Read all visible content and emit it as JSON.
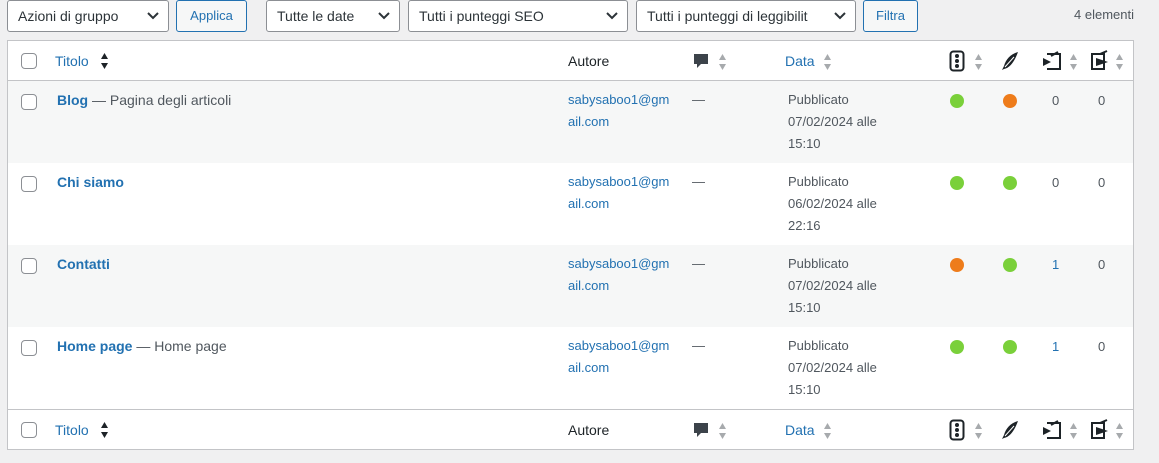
{
  "filters": {
    "bulk_actions": "Azioni di gruppo",
    "apply_label": "Applica",
    "dates": "Tutte le date",
    "seo_scores": "Tutti i punteggi SEO",
    "readability_scores": "Tutti i punteggi di leggibilit",
    "filter_label": "Filtra",
    "item_count": "4 elementi"
  },
  "columns": {
    "title": "Titolo",
    "author": "Autore",
    "date": "Data"
  },
  "icons": {
    "comments": "speech-bubble-icon",
    "seo": "traffic-light-icon",
    "readability": "feather-icon",
    "internal_links_in": "link-in-icon",
    "internal_links_out": "link-out-icon",
    "sort": "sort-arrows-icon"
  },
  "colors": {
    "good": "#7ad03a",
    "ok": "#ee7c1b",
    "link": "#2271b1"
  },
  "rows": [
    {
      "title": "Blog",
      "state": "— Pagina degli articoli",
      "author_l1": "sabysaboo1@gm",
      "author_l2": "ail.com",
      "comments": "—",
      "date_status": "Pubblicato",
      "date_day": "07/02/2024 alle",
      "date_time": "15:10",
      "seo": "good",
      "readability": "ok",
      "links_in": "0",
      "links_out": "0"
    },
    {
      "title": "Chi siamo",
      "state": "",
      "author_l1": "sabysaboo1@gm",
      "author_l2": "ail.com",
      "comments": "—",
      "date_status": "Pubblicato",
      "date_day": "06/02/2024 alle",
      "date_time": "22:16",
      "seo": "good",
      "readability": "good",
      "links_in": "0",
      "links_out": "0"
    },
    {
      "title": "Contatti",
      "state": "",
      "author_l1": "sabysaboo1@gm",
      "author_l2": "ail.com",
      "comments": "—",
      "date_status": "Pubblicato",
      "date_day": "07/02/2024 alle",
      "date_time": "15:10",
      "seo": "ok",
      "readability": "good",
      "links_in": "1",
      "links_out": "0"
    },
    {
      "title": "Home page",
      "state": "— Home page",
      "author_l1": "sabysaboo1@gm",
      "author_l2": "ail.com",
      "comments": "—",
      "date_status": "Pubblicato",
      "date_day": "07/02/2024 alle",
      "date_time": "15:10",
      "seo": "good",
      "readability": "good",
      "links_in": "1",
      "links_out": "0"
    }
  ]
}
